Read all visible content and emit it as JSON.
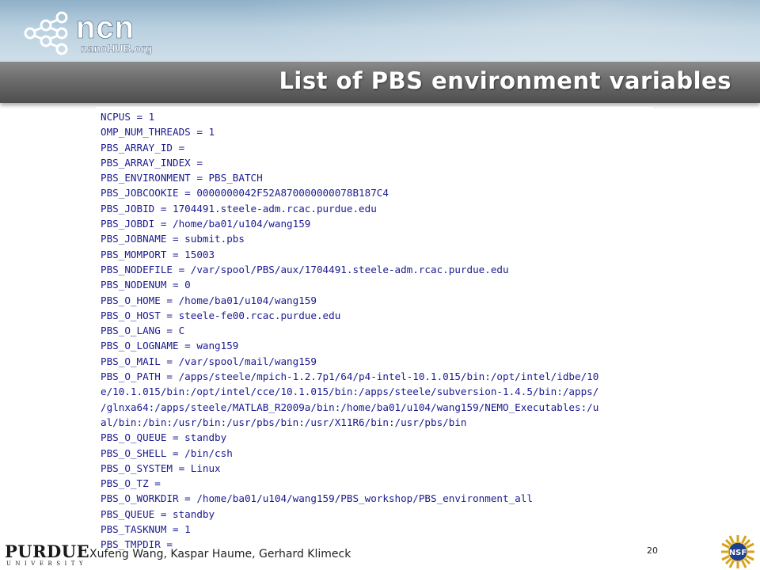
{
  "header": {
    "logo_icon": "ncn-molecule-icon",
    "logo_text": "ncn",
    "logo_subtext": "nanoHUB.org"
  },
  "slide": {
    "title": "List of PBS environment variables",
    "env_lines": [
      "NCPUS = 1",
      "OMP_NUM_THREADS = 1",
      "PBS_ARRAY_ID =",
      "PBS_ARRAY_INDEX =",
      "PBS_ENVIRONMENT = PBS_BATCH",
      "PBS_JOBCOOKIE = 0000000042F52A870000000078B187C4",
      "PBS_JOBID = 1704491.steele-adm.rcac.purdue.edu",
      "PBS_JOBDI = /home/ba01/u104/wang159",
      "PBS_JOBNAME = submit.pbs",
      "PBS_MOMPORT = 15003",
      "PBS_NODEFILE = /var/spool/PBS/aux/1704491.steele-adm.rcac.purdue.edu",
      "PBS_NODENUM = 0",
      "PBS_O_HOME = /home/ba01/u104/wang159",
      "PBS_O_HOST = steele-fe00.rcac.purdue.edu",
      "PBS_O_LANG = C",
      "PBS_O_LOGNAME = wang159",
      "PBS_O_MAIL = /var/spool/mail/wang159",
      "PBS_O_PATH = /apps/steele/mpich-1.2.7p1/64/p4-intel-10.1.015/bin:/opt/intel/idbe/10",
      "e/10.1.015/bin:/opt/intel/cce/10.1.015/bin:/apps/steele/subversion-1.4.5/bin:/apps/",
      "/glnxa64:/apps/steele/MATLAB_R2009a/bin:/home/ba01/u104/wang159/NEMO_Executables:/u",
      "al/bin:/bin:/usr/bin:/usr/pbs/bin:/usr/X11R6/bin:/usr/pbs/bin",
      "PBS_O_QUEUE = standby",
      "PBS_O_SHELL = /bin/csh",
      "PBS_O_SYSTEM = Linux",
      "PBS_O_TZ =",
      "PBS_O_WORKDIR = /home/ba01/u104/wang159/PBS_workshop/PBS_environment_all",
      "PBS_QUEUE = standby",
      "PBS_TASKNUM = 1",
      "PBS_TMPDIR ="
    ]
  },
  "footer": {
    "purdue_word": "PURDUE",
    "purdue_sub": "UNIVERSITY",
    "authors": "Xufeng Wang, Kaspar Haume, Gerhard Klimeck",
    "slide_number": "20",
    "nsf_text": "NSF",
    "nsf_icon": "nsf-seal-icon"
  },
  "colors": {
    "env_text": "#1a1a90",
    "title_bar": "#6e6e6e",
    "header_sky": "#b9d0df"
  }
}
